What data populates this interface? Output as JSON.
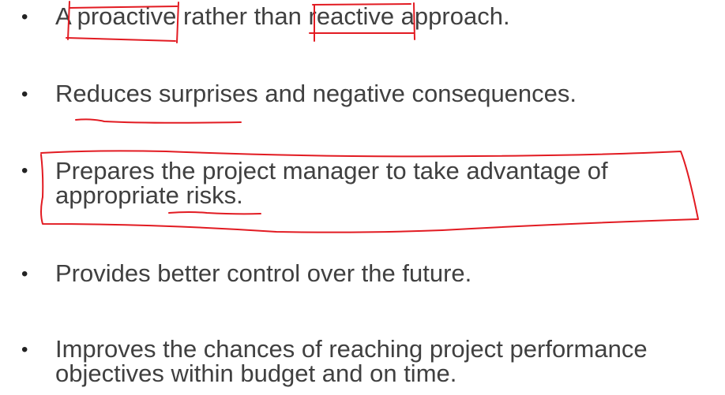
{
  "bullet_char": "•",
  "items": [
    {
      "text": "A proactive rather than reactive approach."
    },
    {
      "text": "Reduces surprises and negative consequences."
    },
    {
      "line1": "Prepares the project manager to take advantage of",
      "line2": "appropriate risks."
    },
    {
      "text": "Provides better control over the future."
    },
    {
      "line1": "Improves the chances of reaching project performance",
      "line2": "objectives within budget and on time."
    }
  ],
  "annotation_color": "#e21b22"
}
